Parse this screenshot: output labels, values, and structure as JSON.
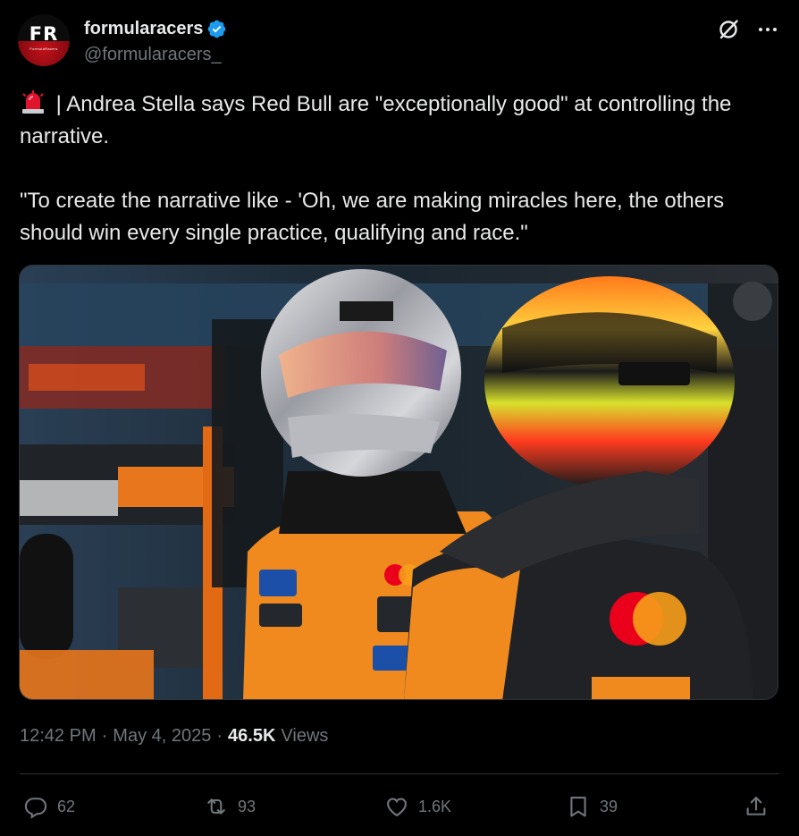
{
  "account": {
    "display_name": "formularacers",
    "handle": "@formularacers_",
    "avatar_text": "FR",
    "avatar_subtext": "FormulaRacers",
    "verified": true
  },
  "post": {
    "emoji": "siren-icon",
    "text": " | Andrea Stella says Red Bull are \"exceptionally good\" at controlling the narrative.\n\n\"To create the narrative like - 'Oh, we are making miracles here, the others should win every single practice, qualifying and race.\""
  },
  "meta": {
    "time": "12:42 PM",
    "separator": "·",
    "date": "May 4, 2025",
    "views_count": "46.5K",
    "views_label": "Views"
  },
  "actions": {
    "replies": "62",
    "reposts": "93",
    "likes": "1.6K",
    "bookmarks": "39"
  },
  "colors": {
    "background": "#000000",
    "text": "#e7e9ea",
    "secondary": "#71767b",
    "verified": "#1d9bf0",
    "border": "#2f3336",
    "papaya": "#ff8000"
  }
}
